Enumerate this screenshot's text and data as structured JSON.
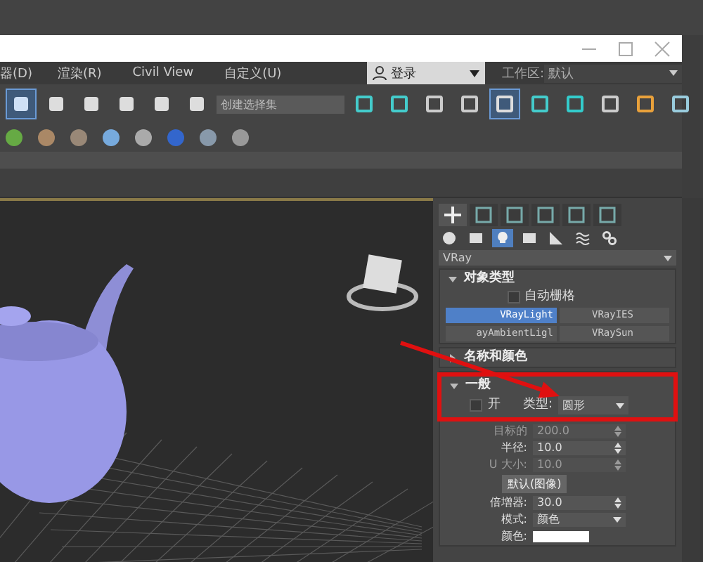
{
  "menu": [
    {
      "label": "器(D)"
    },
    {
      "label": "渲染(R)"
    },
    {
      "label": "Civil View"
    },
    {
      "label": "自定义(U)"
    }
  ],
  "login": {
    "label": "登录"
  },
  "workspace": {
    "label": "工作区:",
    "value": "默认"
  },
  "selection_set": {
    "placeholder": "创建选择集"
  },
  "toolbar_1": [
    {
      "kind": "select",
      "selected": true
    },
    {
      "kind": "snap",
      "selected": false
    },
    {
      "kind": "angle",
      "selected": false
    },
    {
      "kind": "percent",
      "selected": false
    },
    {
      "kind": "spinner",
      "selected": false
    },
    {
      "kind": "braces",
      "selected": false
    }
  ],
  "toolbar_1b": [
    {
      "kind": "mirror",
      "selected": false
    },
    {
      "kind": "align",
      "selected": false
    },
    {
      "kind": "list",
      "selected": false
    },
    {
      "kind": "layers",
      "selected": false
    },
    {
      "kind": "grid",
      "selected": true
    },
    {
      "kind": "wave",
      "selected": false
    },
    {
      "kind": "download",
      "selected": false
    },
    {
      "kind": "nodes",
      "selected": false
    },
    {
      "kind": "teapot",
      "selected": false
    },
    {
      "kind": "globe",
      "selected": false
    }
  ],
  "toolbar_2": [
    {
      "kind": "grass"
    },
    {
      "kind": "hf"
    },
    {
      "kind": "ball"
    },
    {
      "kind": "sphere"
    },
    {
      "kind": "lock"
    },
    {
      "kind": "redblue"
    },
    {
      "kind": "phone"
    },
    {
      "kind": "help"
    }
  ],
  "command_tabs": [
    {
      "kind": "plus",
      "selected": true
    },
    {
      "kind": "curve",
      "selected": false
    },
    {
      "kind": "tree",
      "selected": false
    },
    {
      "kind": "circle",
      "selected": false
    },
    {
      "kind": "monitor",
      "selected": false
    },
    {
      "kind": "wrench",
      "selected": false
    }
  ],
  "sub_tabs": [
    {
      "kind": "dot",
      "selected": false
    },
    {
      "kind": "shapes",
      "selected": false
    },
    {
      "kind": "light",
      "selected": true
    },
    {
      "kind": "camera",
      "selected": false
    },
    {
      "kind": "helper",
      "selected": false
    },
    {
      "kind": "waves",
      "selected": false
    },
    {
      "kind": "gears",
      "selected": false
    }
  ],
  "category": "VRay",
  "object_type": {
    "title": "对象类型",
    "expanded": true,
    "autogrid": {
      "label": "自动栅格",
      "checked": false
    },
    "buttons": [
      {
        "label": "VRayLight",
        "selected": true
      },
      {
        "label": "VRayIES",
        "selected": false
      },
      {
        "label": "ayAmbientLigl",
        "selected": false
      },
      {
        "label": "VRaySun",
        "selected": false
      }
    ]
  },
  "name_color": {
    "title": "名称和颜色",
    "expanded": false
  },
  "general": {
    "title": "一般",
    "expanded": true,
    "on": {
      "label": "开",
      "checked": false
    },
    "type_label": "类型:",
    "type_value": "圆形"
  },
  "params": [
    {
      "kind": "spinner",
      "label": "目标的",
      "value": "200.0",
      "disabled": true
    },
    {
      "kind": "spinner",
      "label": "半径:",
      "value": "10.0",
      "disabled": false
    },
    {
      "kind": "spinner",
      "label": "U 大小:",
      "value": "10.0",
      "disabled": true
    },
    {
      "kind": "button",
      "label": "默认(图像)",
      "disabled": false
    },
    {
      "kind": "spinner",
      "label": "倍增器:",
      "value": "30.0",
      "disabled": false
    },
    {
      "kind": "dropdown",
      "label": "模式:",
      "value": "颜色",
      "disabled": false
    },
    {
      "kind": "swatch",
      "label": "颜色:",
      "disabled": false
    }
  ]
}
